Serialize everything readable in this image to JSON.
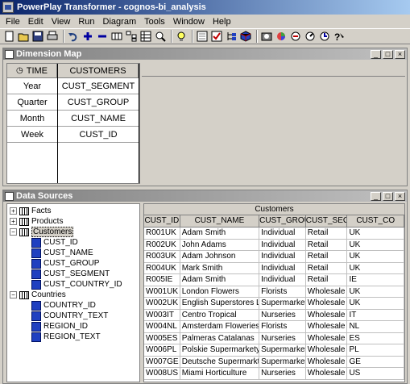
{
  "window": {
    "title": "PowerPlay Transformer - cognos-bi_analysis"
  },
  "menu": [
    "File",
    "Edit",
    "View",
    "Run",
    "Diagram",
    "Tools",
    "Window",
    "Help"
  ],
  "toolbar_icons": [
    "new-icon",
    "open-icon",
    "save-icon",
    "print-icon",
    "undo-icon",
    "add-icon",
    "remove-icon",
    "columns-icon",
    "hierarchy-icon",
    "table-icon",
    "zoom-icon",
    "tip-icon",
    "report-icon",
    "check-icon",
    "tree-icon",
    "cube-icon",
    "camera-icon",
    "chart-icon",
    "measure-icon",
    "dial-icon",
    "process-icon",
    "help-icon"
  ],
  "dimension_map": {
    "title": "Dimension Map",
    "columns": [
      {
        "header": "TIME",
        "icon": "clock-icon",
        "levels": [
          "Year",
          "Quarter",
          "Month",
          "Week"
        ]
      },
      {
        "header": "CUSTOMERS",
        "levels": [
          "CUST_SEGMENT",
          "CUST_GROUP",
          "CUST_NAME",
          "CUST_ID"
        ]
      }
    ]
  },
  "data_sources": {
    "title": "Data Sources",
    "tree": [
      {
        "label": "Facts",
        "expanded": false
      },
      {
        "label": "Products",
        "expanded": false
      },
      {
        "label": "Customers",
        "expanded": true,
        "selected": true,
        "children": [
          "CUST_ID",
          "CUST_NAME",
          "CUST_GROUP",
          "CUST_SEGMENT",
          "CUST_COUNTRY_ID"
        ]
      },
      {
        "label": "Countries",
        "expanded": true,
        "children": [
          "COUNTRY_ID",
          "COUNTRY_TEXT",
          "REGION_ID",
          "REGION_TEXT"
        ]
      }
    ]
  },
  "grid": {
    "title": "Customers",
    "headers": [
      "CUST_ID",
      "CUST_NAME",
      "CUST_GROU",
      "CUST_SEGI",
      "CUST_CO"
    ],
    "rows": [
      [
        "R001UK",
        "Adam Smith",
        "Individual",
        "Retail",
        "UK"
      ],
      [
        "R002UK",
        "John Adams",
        "Individual",
        "Retail",
        "UK"
      ],
      [
        "R003UK",
        "Adam Johnson",
        "Individual",
        "Retail",
        "UK"
      ],
      [
        "R004UK",
        "Mark Smith",
        "Individual",
        "Retail",
        "UK"
      ],
      [
        "R005IE",
        "Adam Smith",
        "Individual",
        "Retail",
        "IE"
      ],
      [
        "W001UK",
        "London Flowers",
        "Florists",
        "Wholesale",
        "UK"
      ],
      [
        "W002UK",
        "English Superstores Ltd",
        "Supermarkets",
        "Wholesale",
        "UK"
      ],
      [
        "W003IT",
        "Centro Tropical",
        "Nurseries",
        "Wholesale",
        "IT"
      ],
      [
        "W004NL",
        "Amsterdam Floweries",
        "Florists",
        "Wholesale",
        "NL"
      ],
      [
        "W005ES",
        "Palmeras Catalanas",
        "Nurseries",
        "Wholesale",
        "ES"
      ],
      [
        "W006PL",
        "Polskie Supermarkety S.A.",
        "Supermarkets",
        "Wholesale",
        "PL"
      ],
      [
        "W007GE",
        "Deutsche Supermarkt GmE",
        "Supermarkets",
        "Wholesale",
        "GE"
      ],
      [
        "W008US",
        "Miami Horticulture",
        "Nurseries",
        "Wholesale",
        "US"
      ]
    ]
  }
}
